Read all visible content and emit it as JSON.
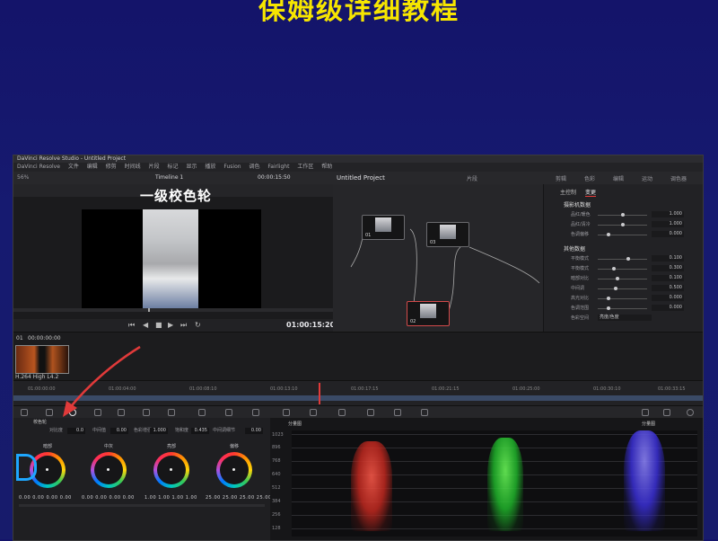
{
  "slide": {
    "title": "保姆级详细教程",
    "annotation": "一级校色轮"
  },
  "colors": {
    "title": "#f6e500",
    "accent_red": "#e03a3a",
    "annotation_blue": "#1ea7ff"
  },
  "app": {
    "window_title": "DaVinci Resolve Studio - Untitled Project",
    "menu": [
      "DaVinci Resolve",
      "文件",
      "编辑",
      "修剪",
      "时间线",
      "片段",
      "标记",
      "显示",
      "播放",
      "Fusion",
      "调色",
      "Fairlight",
      "工作区",
      "帮助"
    ],
    "toolbar": {
      "zoom": "56%",
      "timeline_name": "Timeline 1",
      "timecode_top": "00:00:15:50",
      "project_title": "Untitled Project",
      "clip_label": "片段",
      "right_items": [
        "剪辑",
        "色彩",
        "编辑",
        "运动",
        "调色器"
      ]
    },
    "viewer": {
      "timecode": "01:00:15:20"
    },
    "nodes": [
      {
        "label": "01"
      },
      {
        "label": "03"
      },
      {
        "label": "02"
      }
    ],
    "inspector": {
      "tabs": [
        "主控制",
        "变更"
      ],
      "section1": "摄影机数据",
      "rows1": [
        {
          "label": "品红/暖色",
          "value": "1.000"
        },
        {
          "label": "品红/清冷",
          "value": "1.000"
        },
        {
          "label": "色调偏移",
          "value": "0.000"
        }
      ],
      "section2": "其他数据",
      "rows2": [
        {
          "label": "平衡模式",
          "value": "0.100"
        },
        {
          "label": "平衡模式",
          "value": "0.300"
        },
        {
          "label": "暗部对比",
          "value": "0.100"
        },
        {
          "label": "中间调",
          "value": "0.500"
        },
        {
          "label": "高光对比",
          "value": "0.000"
        },
        {
          "label": "色调范围",
          "value": "0.000"
        }
      ],
      "last_row_label": "色彩空间",
      "last_row_value": "亮度/色度"
    },
    "clip": {
      "timecode": "00:00:00:00",
      "index": "01",
      "codec": "H.264 High L4.2"
    },
    "ruler_ticks": [
      "01:00:00:00",
      "01:00:04:00",
      "01:00:08:10",
      "01:00:13:10",
      "01:00:17:15",
      "01:00:21:15",
      "01:00:25:00",
      "01:00:30:10",
      "01:00:33:15"
    ],
    "wheels": {
      "panel_title": "校色轮",
      "params": [
        {
          "label": "对比度",
          "value": "0.0"
        },
        {
          "label": "中间值",
          "value": "0.00"
        },
        {
          "label": "色彩增强",
          "value": "1.000"
        },
        {
          "label": "饱和度",
          "value": "0.435"
        },
        {
          "label": "中间调细节",
          "value": "0.00"
        }
      ],
      "items": [
        {
          "name": "暗部",
          "values": [
            "0.00",
            "0.00",
            "0.00",
            "0.00"
          ]
        },
        {
          "name": "中灰",
          "values": [
            "0.00",
            "0.00",
            "0.00",
            "0.00"
          ]
        },
        {
          "name": "亮部",
          "values": [
            "1.00",
            "1.00",
            "1.00",
            "1.00"
          ]
        },
        {
          "name": "偏移",
          "values": [
            "25.00",
            "25.00",
            "25.00",
            "25.00"
          ]
        }
      ]
    },
    "scope": {
      "title": "分量图",
      "mode": "分量图",
      "ylabels": [
        "1023",
        "896",
        "768",
        "640",
        "512",
        "384",
        "256",
        "128"
      ]
    }
  }
}
